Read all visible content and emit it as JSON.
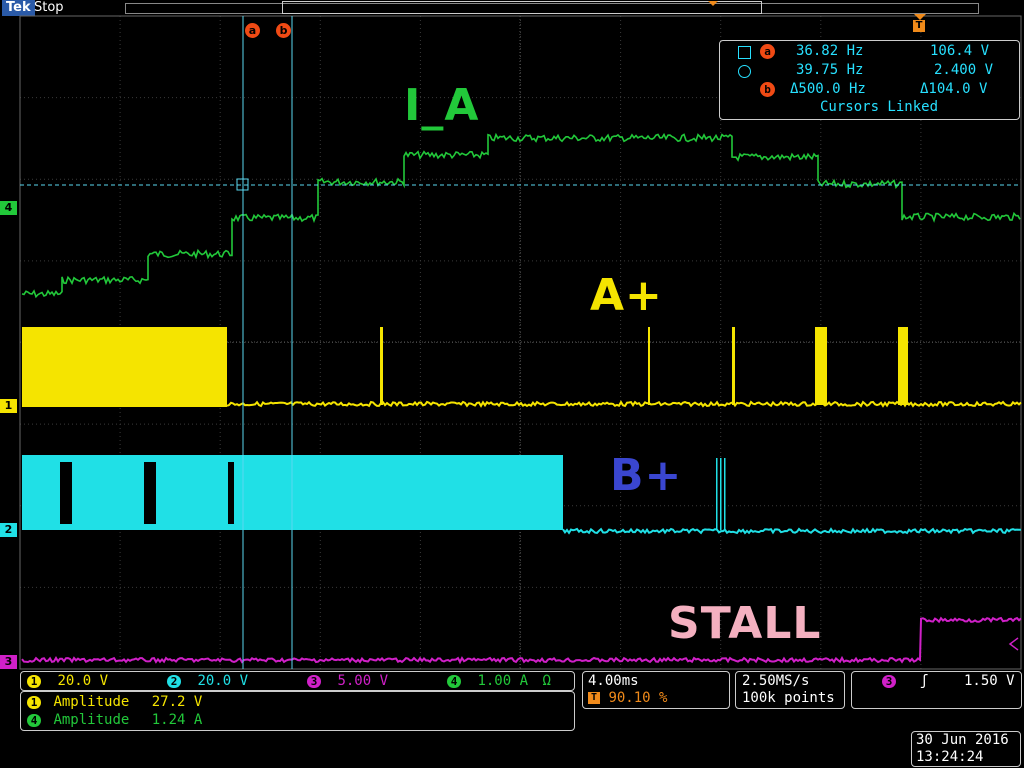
{
  "header": {
    "brand": "Tek",
    "run_state": "Stop"
  },
  "trace_labels": {
    "ia": "I_A",
    "a_plus": "A+",
    "b_plus": "B+",
    "stall": "STALL"
  },
  "cursor_markers": {
    "a": "a",
    "b": "b",
    "trigger": "T"
  },
  "channel_markers": {
    "ch1": "1",
    "ch2": "2",
    "ch3": "3",
    "ch4": "4"
  },
  "cursor_readout": {
    "a_freq": "36.82 Hz",
    "a_volt": "106.4 V",
    "b_freq": "39.75 Hz",
    "b_volt": "2.400 V",
    "delta_freq": "Δ500.0 Hz",
    "delta_volt": "Δ104.0 V",
    "linked": "Cursors Linked"
  },
  "channels": [
    {
      "num": "1",
      "scale": "20.0 V",
      "color": "#f5e400"
    },
    {
      "num": "2",
      "scale": "20.0 V",
      "color": "#20e0e6"
    },
    {
      "num": "3",
      "scale": "5.00 V",
      "color": "#d020c8"
    },
    {
      "num": "4",
      "scale": "1.00 A",
      "suffix": "Ω",
      "color": "#22c83a"
    }
  ],
  "measurements": [
    {
      "ch": "1",
      "name": "Amplitude",
      "value": "27.2 V"
    },
    {
      "ch": "4",
      "name": "Amplitude",
      "value": "1.24 A"
    }
  ],
  "horizontal": {
    "scale": "4.00ms",
    "trigger_pos": "90.10 %"
  },
  "acquisition": {
    "rate": "2.50MS/s",
    "points": "100k points"
  },
  "trigger": {
    "ch": "3",
    "slope": "ʃ",
    "level": "1.50 V"
  },
  "datetime": {
    "date": "30 Jun 2016",
    "time": "13:24:24"
  },
  "colors": {
    "ch1": "#f5e400",
    "ch2": "#20e0e6",
    "ch3": "#d020c8",
    "ch4": "#22c83a",
    "cursor": "#f04a14",
    "label_b": "#3a46d0",
    "label_stall": "#f4b0c0"
  }
}
